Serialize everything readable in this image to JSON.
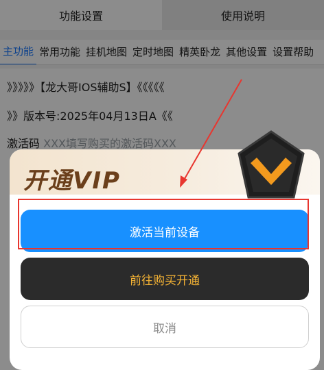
{
  "app": {
    "top_tabs": [
      "功能设置",
      "使用说明"
    ],
    "sub_tabs": [
      "主功能",
      "常用功能",
      "挂机地图",
      "定时地图",
      "精英卧龙",
      "其他设置",
      "设置帮助"
    ],
    "lines": {
      "title": "》》》》》【龙大哥IOS辅助S】《《《《《",
      "version": "》》版本号:2025年04月13日A《《",
      "code_label": "激活码",
      "code_placeholder": "XXX填写购买的激活码XXX"
    }
  },
  "dialog": {
    "banner_title": "开通VIP",
    "activate_label": "激活当前设备",
    "buy_label": "前往购买开通",
    "cancel_label": "取消"
  },
  "colors": {
    "primary": "#1890ff",
    "dark": "#2b2b2b",
    "gold": "#f5b334",
    "highlight": "#e8362f"
  }
}
